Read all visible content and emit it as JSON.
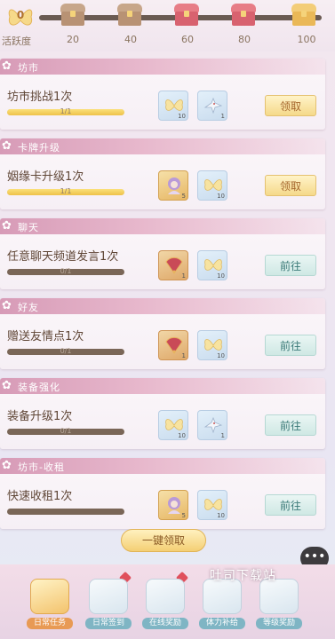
{
  "activity": {
    "value": "0",
    "label": "活跃度",
    "milestones": [
      "20",
      "40",
      "60",
      "80",
      "100"
    ]
  },
  "tasks": [
    {
      "category": "坊市",
      "title": "坊市挑战1次",
      "progress_text": "1/1",
      "progress": 1.0,
      "rewards": [
        {
          "icon": "butterfly-icon",
          "count": "10"
        },
        {
          "icon": "bird-icon",
          "count": "1"
        }
      ],
      "button": "领取",
      "button_type": "claim"
    },
    {
      "category": "卡牌升级",
      "title": "姻缘卡升级1次",
      "progress_text": "1/1",
      "progress": 1.0,
      "rewards": [
        {
          "icon": "character-icon",
          "count": "5"
        },
        {
          "icon": "butterfly-icon",
          "count": "10"
        }
      ],
      "button": "领取",
      "button_type": "claim"
    },
    {
      "category": "聊天",
      "title": "任意聊天频道发言1次",
      "progress_text": "0/1",
      "progress": 0.0,
      "rewards": [
        {
          "icon": "fan-icon",
          "count": "1"
        },
        {
          "icon": "butterfly-icon",
          "count": "10"
        }
      ],
      "button": "前往",
      "button_type": "go"
    },
    {
      "category": "好友",
      "title": "赠送友情点1次",
      "progress_text": "0/1",
      "progress": 0.0,
      "rewards": [
        {
          "icon": "fan-icon",
          "count": "1"
        },
        {
          "icon": "butterfly-icon",
          "count": "10"
        }
      ],
      "button": "前往",
      "button_type": "go"
    },
    {
      "category": "装备强化",
      "title": "装备升级1次",
      "progress_text": "0/1",
      "progress": 0.0,
      "rewards": [
        {
          "icon": "butterfly-icon",
          "count": "10"
        },
        {
          "icon": "bird-icon",
          "count": "1"
        }
      ],
      "button": "前往",
      "button_type": "go"
    },
    {
      "category": "坊市-收租",
      "title": "快速收租1次",
      "progress_text": "",
      "progress": 0.0,
      "rewards": [
        {
          "icon": "character-icon",
          "count": "5"
        },
        {
          "icon": "butterfly-icon",
          "count": "10"
        }
      ],
      "button": "前往",
      "button_type": "go"
    }
  ],
  "one_click": "一键领取",
  "bottom_tabs": [
    {
      "label": "日常任务",
      "active": true
    },
    {
      "label": "日常签到",
      "active": false
    },
    {
      "label": "在线奖励",
      "active": false
    },
    {
      "label": "体力补给",
      "active": false
    },
    {
      "label": "等级奖励",
      "active": false
    }
  ],
  "watermark": "吐司下载站",
  "colors": {
    "accent": "#e89a54",
    "claim": "#f5d98a",
    "go": "#cfe8e4",
    "header": "#d79bb7"
  }
}
